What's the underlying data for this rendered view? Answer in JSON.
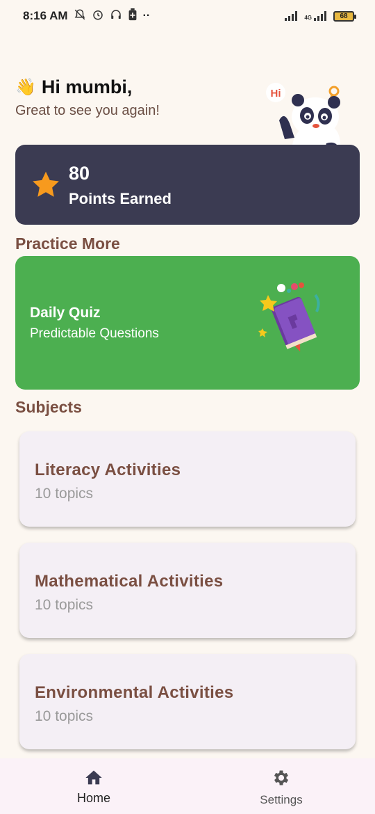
{
  "status_bar": {
    "time": "8:16 AM",
    "icons": [
      "silent-icon",
      "alarm-icon",
      "headset-icon",
      "battery-saver-icon",
      "more-dots-icon"
    ],
    "network": "4G",
    "battery": "68"
  },
  "greeting": {
    "emoji": "👋",
    "title": "Hi mumbi,",
    "subtitle": "Great to see you again!",
    "mascot_bubble": "Hi"
  },
  "points": {
    "value": "80",
    "label": "Points Earned",
    "icon": "star-icon"
  },
  "practice": {
    "section_title": "Practice More",
    "quiz_title": "Daily Quiz",
    "quiz_subtitle": "Predictable Questions"
  },
  "subjects": {
    "section_title": "Subjects",
    "items": [
      {
        "title": "Literacy Activities",
        "topics": "10 topics"
      },
      {
        "title": "Mathematical Activities",
        "topics": "10 topics"
      },
      {
        "title": "Environmental Activities",
        "topics": "10 topics"
      }
    ]
  },
  "nav": {
    "home_label": "Home",
    "settings_label": "Settings"
  },
  "colors": {
    "background": "#fcf7f1",
    "points_card": "#3b3b52",
    "quiz_card": "#4caf50",
    "subject_card": "#f4eff5",
    "brown_text": "#7a4f42",
    "star": "#f79a1e"
  }
}
